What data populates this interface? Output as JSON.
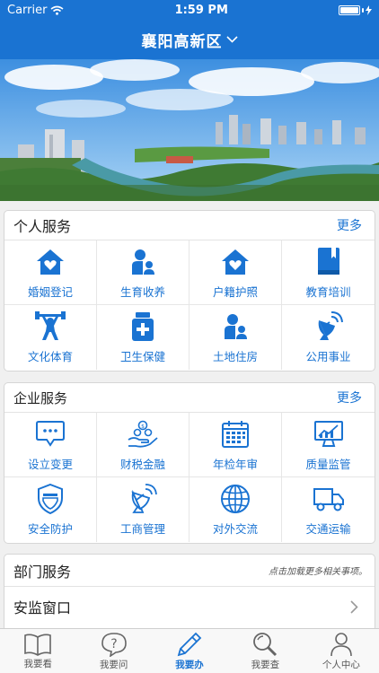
{
  "status": {
    "carrier": "Carrier",
    "time": "1:59 PM",
    "battery_level": 1.0
  },
  "header": {
    "title": "襄阳高新区"
  },
  "colors": {
    "brand": "#1a73d2"
  },
  "personal": {
    "title": "个人服务",
    "more": "更多",
    "items": [
      {
        "label": "婚姻登记",
        "icon": "house-heart-icon"
      },
      {
        "label": "生育收养",
        "icon": "parent-child-icon"
      },
      {
        "label": "户籍护照",
        "icon": "house-heart-icon"
      },
      {
        "label": "教育培训",
        "icon": "book-icon"
      },
      {
        "label": "文化体育",
        "icon": "weightlifter-icon"
      },
      {
        "label": "卫生保健",
        "icon": "medicine-bottle-icon"
      },
      {
        "label": "土地住房",
        "icon": "parent-child-icon"
      },
      {
        "label": "公用事业",
        "icon": "satellite-dish-icon"
      }
    ]
  },
  "enterprise": {
    "title": "企业服务",
    "more": "更多",
    "items": [
      {
        "label": "设立变更",
        "icon": "chat-bubble-icon"
      },
      {
        "label": "财税金融",
        "icon": "hand-coins-icon"
      },
      {
        "label": "年检年审",
        "icon": "calendar-icon"
      },
      {
        "label": "质量监管",
        "icon": "monitor-chart-icon"
      },
      {
        "label": "安全防护",
        "icon": "shield-icon"
      },
      {
        "label": "工商管理",
        "icon": "satellite-dish-icon"
      },
      {
        "label": "对外交流",
        "icon": "globe-icon"
      },
      {
        "label": "交通运输",
        "icon": "truck-icon"
      }
    ]
  },
  "department": {
    "title": "部门服务",
    "hint": "点击加载更多相关事项。",
    "rows": [
      {
        "label": "安监窗口"
      }
    ]
  },
  "tabs": [
    {
      "label": "我要看",
      "icon": "book-open-icon"
    },
    {
      "label": "我要问",
      "icon": "question-bubble-icon"
    },
    {
      "label": "我要办",
      "icon": "pencil-icon",
      "active": true
    },
    {
      "label": "我要查",
      "icon": "magnifier-icon"
    },
    {
      "label": "个人中心",
      "icon": "person-icon"
    }
  ]
}
